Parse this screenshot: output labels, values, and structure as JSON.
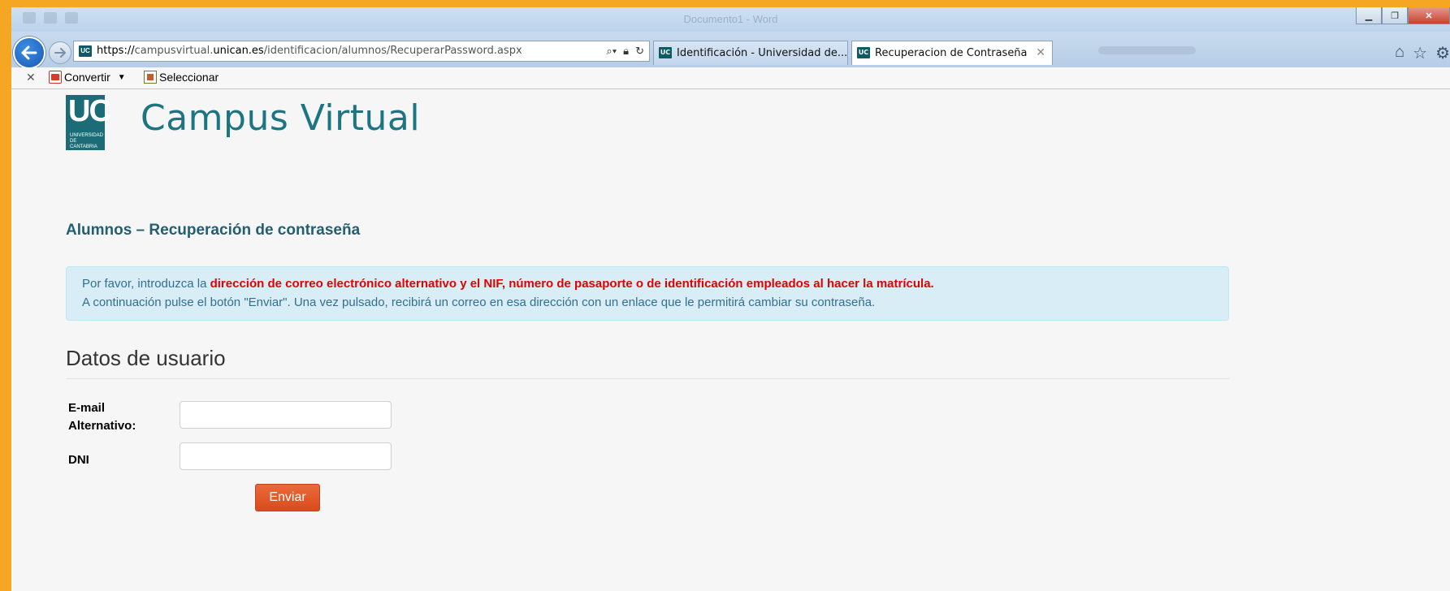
{
  "browser": {
    "window_title": "Documento1 - Word",
    "address": {
      "protocol": "https://",
      "subdomain": "campusvirtual.",
      "host": "unican.es",
      "path": "/identificacion/alumnos/RecuperarPassword.aspx"
    },
    "tabs": [
      {
        "label": "Identificación - Universidad de...",
        "favicon": "UC",
        "active": false
      },
      {
        "label": "Recuperacion de Contraseña",
        "favicon": "UC",
        "active": true
      }
    ],
    "command_bar": {
      "items": [
        {
          "label": "Convertir",
          "icon": "pdf-convert-icon"
        },
        {
          "label": "Seleccionar",
          "icon": "select-icon"
        }
      ]
    }
  },
  "page": {
    "logo": {
      "text": "UC",
      "subtitle_line1": "UNIVERSIDAD",
      "subtitle_line2": "DE CANTABRIA"
    },
    "site_title": "Campus Virtual",
    "section_heading": "Alumnos – Recuperación de contraseña",
    "alert": {
      "line1_prefix": "Por favor, introduzca la ",
      "line1_emphasis": "dirección de correo electrónico alternativo y el NIF, número de pasaporte o de identificación empleados al hacer la matrícula.",
      "line2": "A continuación pulse el botón \"Enviar\". Una vez pulsado, recibirá un correo en esa dirección con un enlace que le permitirá cambiar su contraseña."
    },
    "form": {
      "heading": "Datos de usuario",
      "email_label": "E-mail Alternativo:",
      "email_value": "",
      "dni_label": "DNI",
      "dni_value": "",
      "submit_label": "Enviar"
    }
  },
  "colors": {
    "frame_border": "#f5a623",
    "brand_teal": "#1d7582",
    "alert_bg": "#d9edf7",
    "alert_text": "#31708f",
    "alert_emphasis": "#e30000",
    "submit_bg": "#e05a2a"
  }
}
